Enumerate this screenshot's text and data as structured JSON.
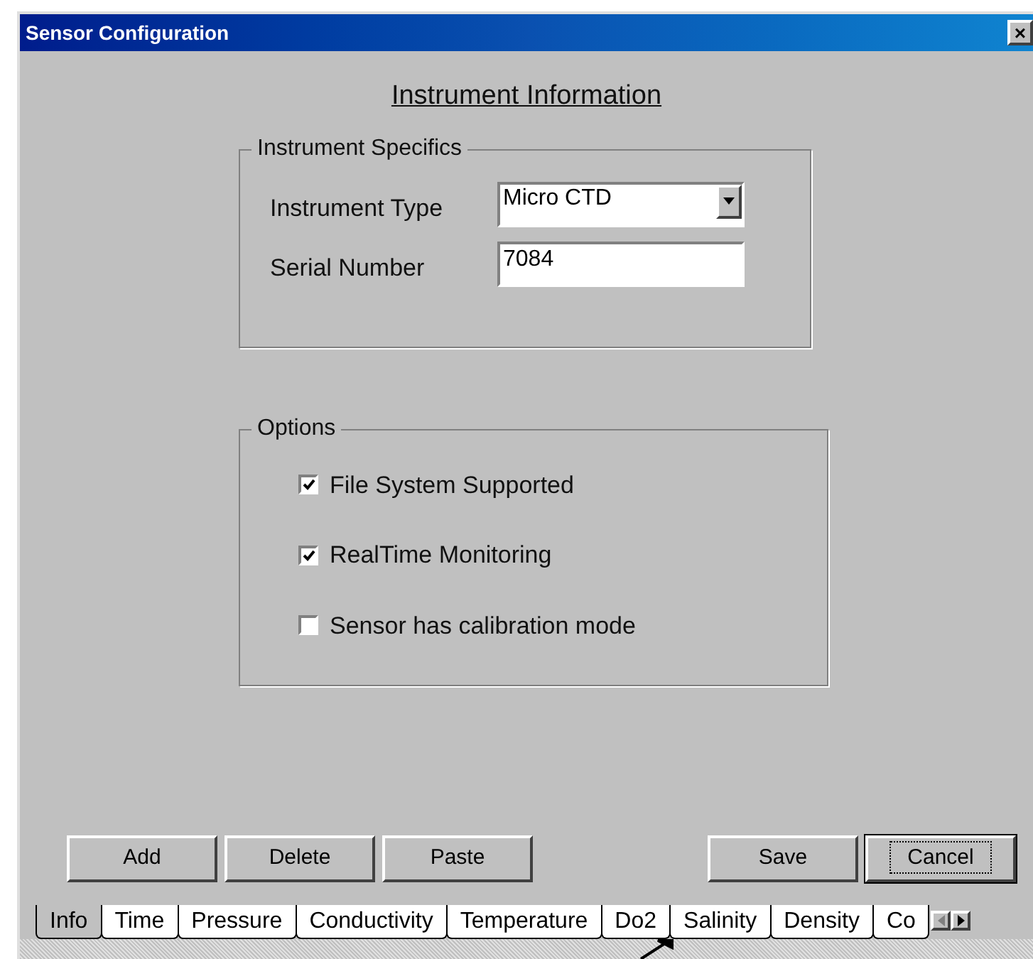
{
  "window": {
    "title": "Sensor Configuration",
    "close": "×"
  },
  "heading": "Instrument Information",
  "instrument_specifics": {
    "legend": "Instrument Specifics",
    "instrument_type": {
      "label": "Instrument Type",
      "value": "Micro CTD"
    },
    "serial_number": {
      "label": "Serial Number",
      "value": "7084"
    }
  },
  "options": {
    "legend": "Options",
    "items": [
      {
        "label": "File System Supported",
        "checked": true
      },
      {
        "label": "RealTime Monitoring",
        "checked": true
      },
      {
        "label": "Sensor has calibration mode",
        "checked": false
      }
    ]
  },
  "buttons_left": [
    {
      "label": "Add",
      "default": false
    },
    {
      "label": "Delete",
      "default": false
    },
    {
      "label": "Paste",
      "default": false
    }
  ],
  "buttons_right": [
    {
      "label": "Save",
      "default": false
    },
    {
      "label": "Cancel",
      "default": true
    }
  ],
  "tabs": [
    {
      "label": "Info",
      "selected": true
    },
    {
      "label": "Time",
      "selected": false
    },
    {
      "label": "Pressure",
      "selected": false
    },
    {
      "label": "Conductivity",
      "selected": false
    },
    {
      "label": "Temperature",
      "selected": false
    },
    {
      "label": "Do2",
      "selected": false
    },
    {
      "label": "Salinity",
      "selected": false
    },
    {
      "label": "Density",
      "selected": false
    },
    {
      "label": "Co",
      "selected": false
    }
  ]
}
